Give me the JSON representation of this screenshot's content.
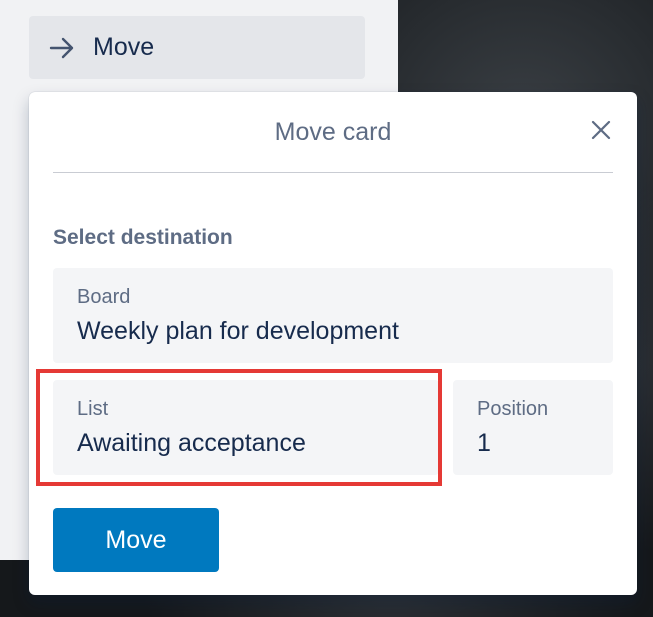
{
  "sidebar": {
    "move_action": {
      "label": "Move",
      "icon": "arrow-right-icon"
    }
  },
  "popover": {
    "title": "Move card",
    "close_icon": "close-icon",
    "section_title": "Select destination",
    "board": {
      "label": "Board",
      "value": "Weekly plan for development"
    },
    "list": {
      "label": "List",
      "value": "Awaiting acceptance"
    },
    "position": {
      "label": "Position",
      "value": "1"
    },
    "submit_label": "Move"
  },
  "colors": {
    "primary_button": "#0079bf",
    "highlight": "#e53935"
  }
}
